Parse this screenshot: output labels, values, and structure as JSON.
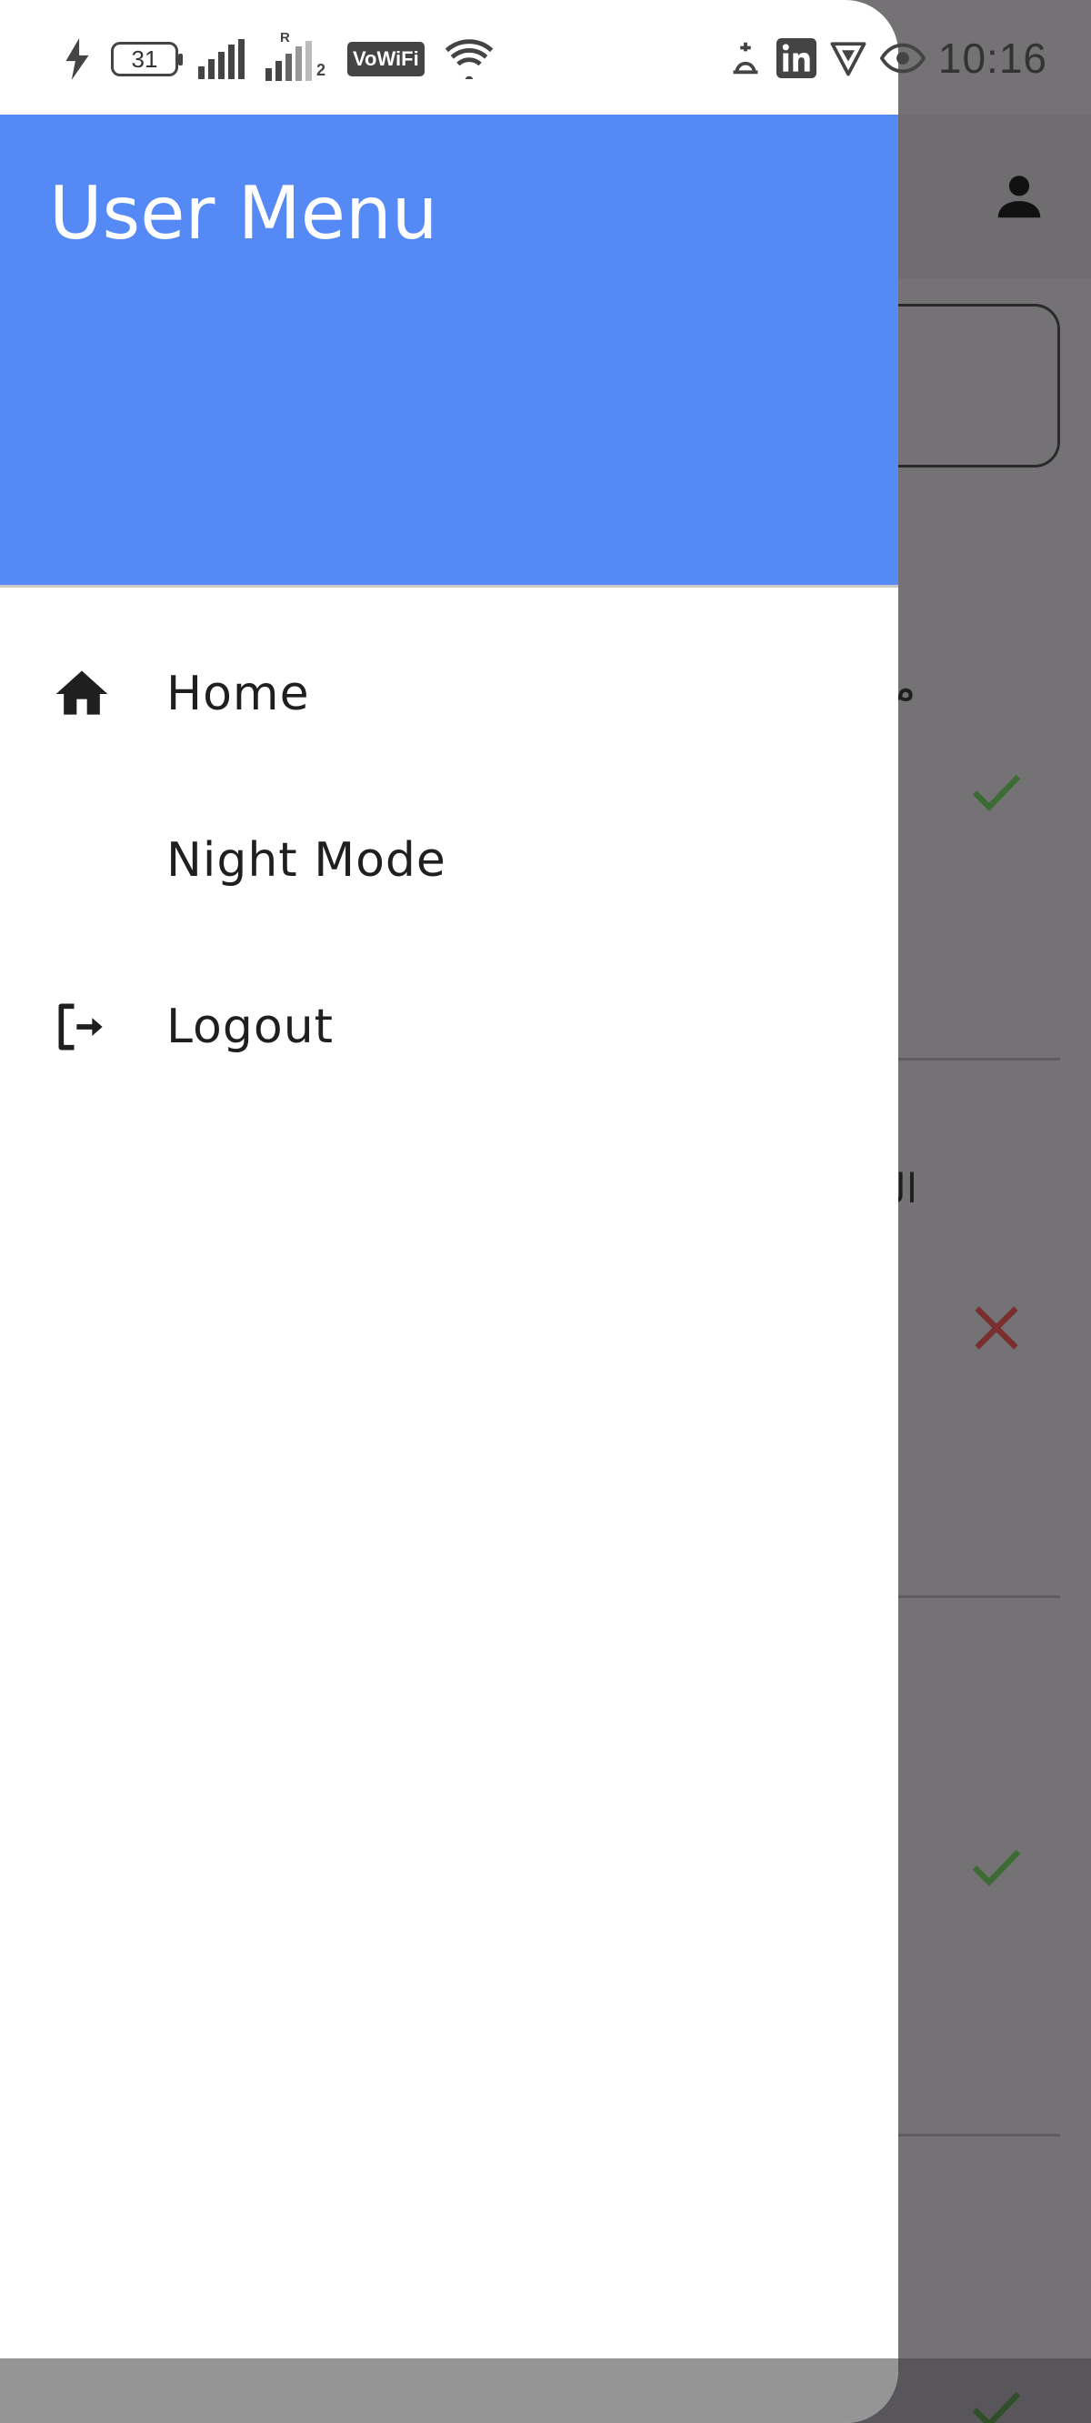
{
  "status_bar": {
    "battery_level": "31",
    "wifi_calling": "VoWiFi",
    "sim2_label": "2",
    "roaming_label": "R",
    "time": "10:16",
    "icons": [
      "charging-icon",
      "battery-icon",
      "signal-icon",
      "signal-roaming-icon",
      "vowifi-icon",
      "wifi-icon",
      "prayer-app-icon",
      "linkedin-icon",
      "vpn-shield-icon",
      "eye-comfort-icon"
    ]
  },
  "drawer": {
    "title": "User Menu",
    "items": [
      {
        "label": "Home",
        "icon": "home-icon"
      },
      {
        "label": "Night Mode",
        "icon": "moon-icon"
      },
      {
        "label": "Logout",
        "icon": "logout-icon"
      }
    ]
  },
  "background_app": {
    "card_texts": [
      "من",
      "الع"
    ],
    "results": [
      "correct",
      "incorrect",
      "correct",
      "correct"
    ],
    "colors": {
      "correct": "#3d6b34",
      "incorrect": "#7a2e2e",
      "scrim": "#747275"
    }
  }
}
